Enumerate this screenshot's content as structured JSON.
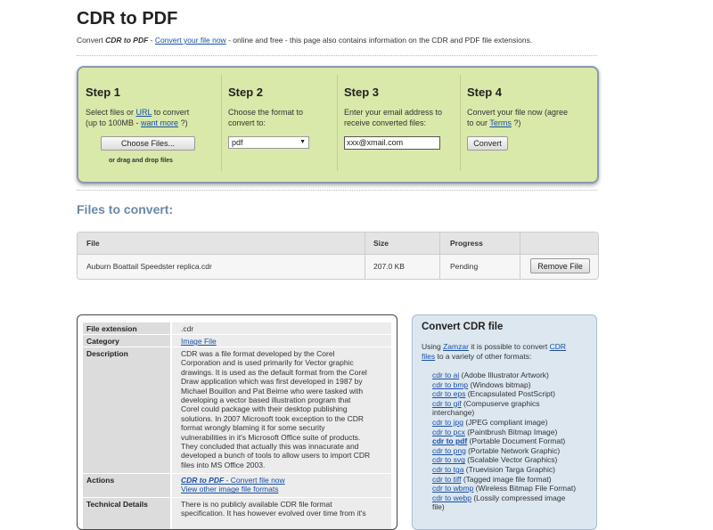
{
  "page": {
    "title": "CDR to PDF",
    "intro": {
      "pre": "Convert ",
      "bold": "CDR to PDF",
      "dash": " - ",
      "link": "Convert your file now",
      "post": " - online and free - this page also contains information on the CDR and PDF file extensions."
    }
  },
  "steps": [
    {
      "heading": "Step 1",
      "desc_a": "Select files or ",
      "desc_link": "URL",
      "desc_b": " to convert",
      "desc_c": "(up to 100MB - ",
      "desc_link2": "want more",
      "desc_d": " ?)",
      "button": "Choose Files...",
      "drag": "or drag and drop files"
    },
    {
      "heading": "Step 2",
      "desc_a": "Choose the format to",
      "desc_b": "convert to:",
      "select_value": "pdf"
    },
    {
      "heading": "Step 3",
      "desc_a": "Enter your email address to",
      "desc_b": "receive converted files:",
      "email_value": "xxx@xmail.com"
    },
    {
      "heading": "Step 4",
      "desc_a": "Convert your file now (agree",
      "desc_b": "to our ",
      "desc_link": "Terms",
      "desc_c": " ?)",
      "button": "Convert"
    }
  ],
  "files": {
    "heading": "Files to convert:",
    "columns": [
      "File",
      "Size",
      "Progress"
    ],
    "rows": [
      {
        "file": "Auburn Boattail Speedster replica.cdr",
        "size": "207.0 KB",
        "progress": "Pending",
        "action": "Remove File"
      }
    ]
  },
  "details": {
    "rows": [
      {
        "label": "File extension",
        "value": ".cdr"
      },
      {
        "label": "Category",
        "value_link": "Image File"
      },
      {
        "label": "Description",
        "lines": [
          "CDR was a file format developed by the Corel",
          "Corporation and is used primarily for Vector graphic",
          "drawings. It is used as the default format from the Corel",
          "Draw application which was first developed in 1987 by",
          "Michael Bouillon and Pat Beirne who were tasked with",
          "developing a vector based illustration program that",
          "Corel could package with their desktop publishing",
          "solutions. In 2007 Microsoft took exception to the CDR",
          "format wrongly blaming it for some security",
          "vulnerabilities in it's Microsoft Office suite of products.",
          "They concluded that actually this was innacurate and",
          "developed a bunch of tools to allow users to import CDR",
          "files into MS Office 2003."
        ]
      },
      {
        "label": "Actions",
        "action1_bold": "CDR to PDF",
        "action1_rest": " - Convert file now",
        "action2": "View other image file formats"
      },
      {
        "label": "Technical Details",
        "lines": [
          "There is no publicly available CDR file format",
          "specification. It has however evolved over time from it's"
        ]
      }
    ]
  },
  "sidebar": {
    "heading": "Convert CDR file",
    "desc_a": "Using ",
    "desc_link": "Zamzar",
    "desc_b": " it is possible to convert ",
    "desc_link2": "CDR",
    "desc_link3": "files",
    "desc_c": " to a variety of other formats:",
    "conversions": [
      {
        "link": "cdr to ai",
        "desc": " (Adobe Illustrator Artwork)",
        "bold": false
      },
      {
        "link": "cdr to bmp",
        "desc": " (Windows bitmap)",
        "bold": false
      },
      {
        "link": "cdr to eps",
        "desc": " (Encapsulated PostScript)",
        "bold": false
      },
      {
        "link": "cdr to gif",
        "desc": " (Compuserve graphics",
        "desc2": "interchange)",
        "bold": false
      },
      {
        "link": "cdr to jpg",
        "desc": " (JPEG compliant image)",
        "bold": false
      },
      {
        "link": "cdr to pcx",
        "desc": " (Paintbrush Bitmap Image)",
        "bold": false
      },
      {
        "link": "cdr to pdf",
        "desc": " (Portable Document Format)",
        "bold": true
      },
      {
        "link": "cdr to png",
        "desc": " (Portable Network Graphic)",
        "bold": false
      },
      {
        "link": "cdr to svg",
        "desc": " (Scalable Vector Graphics)",
        "bold": false
      },
      {
        "link": "cdr to tga",
        "desc": " (Truevision Targa Graphic)",
        "bold": false
      },
      {
        "link": "cdr to tiff",
        "desc": " (Tagged image file format)",
        "bold": false
      },
      {
        "link": "cdr to wbmp",
        "desc": " (Wireless Bitmap File Format)",
        "bold": false
      },
      {
        "link": "cdr to webp",
        "desc": " (Lossily compressed image",
        "desc2": "file)",
        "bold": false
      }
    ]
  }
}
